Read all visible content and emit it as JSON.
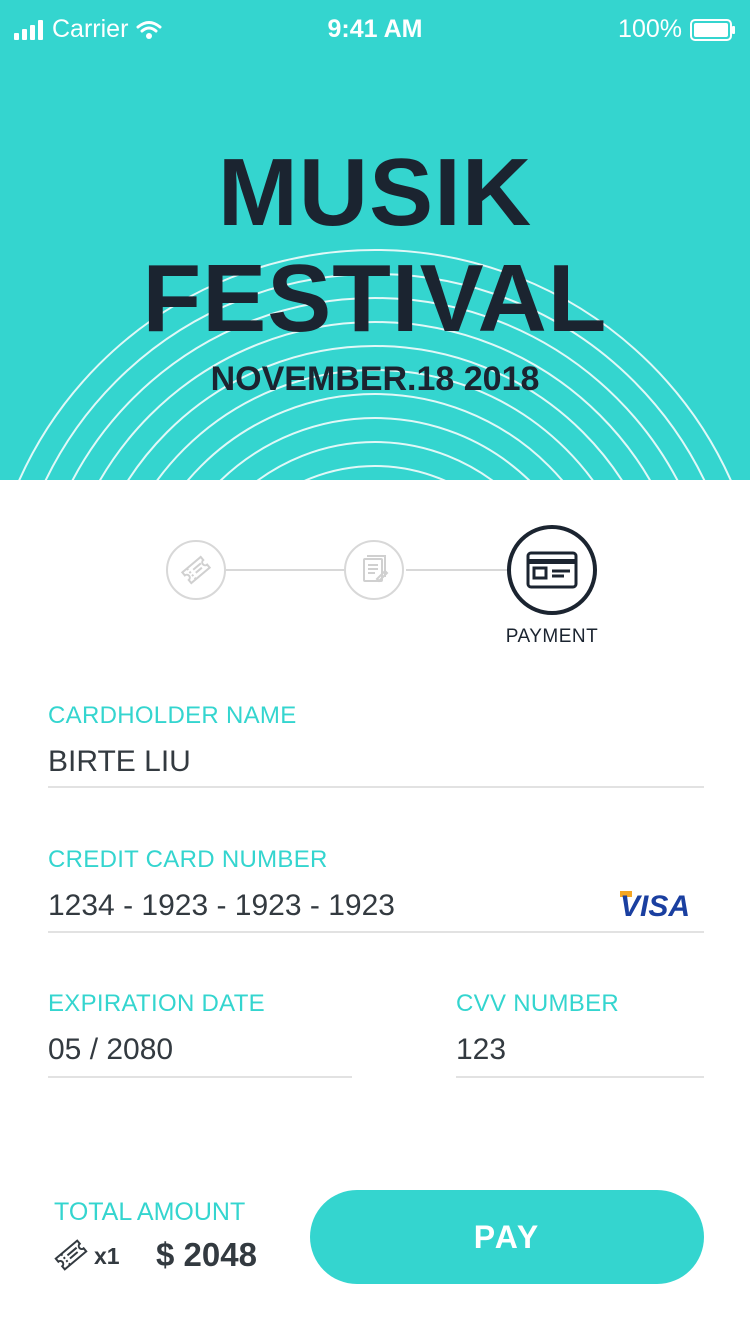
{
  "status_bar": {
    "carrier": "Carrier",
    "time": "9:41 AM",
    "battery": "100%"
  },
  "hero": {
    "title_line1": "MUSIK",
    "title_line2": "FESTIVAL",
    "date": "NOVEMBER.18 2018",
    "background_color": "#34d5cf"
  },
  "stepper": {
    "steps": [
      {
        "icon": "ticket-icon",
        "state": "completed"
      },
      {
        "icon": "document-icon",
        "state": "completed"
      },
      {
        "icon": "credit-card-icon",
        "state": "active",
        "label": "PAYMENT"
      }
    ]
  },
  "form": {
    "cardholder": {
      "label": "CARDHOLDER NAME",
      "value": "BIRTE LIU"
    },
    "card_number": {
      "label": "CREDIT CARD NUMBER",
      "value": "1234 - 1923 - 1923 - 1923",
      "brand": "VISA"
    },
    "expiration": {
      "label": "EXPIRATION DATE",
      "value": "05 / 2080"
    },
    "cvv": {
      "label": "CVV NUMBER",
      "value": "123"
    }
  },
  "footer": {
    "total_label": "TOTAL AMOUNT",
    "quantity": "x1",
    "amount": "$ 2048",
    "pay_label": "PAY"
  },
  "colors": {
    "accent": "#34d5cf",
    "dark": "#1b2430",
    "visa_blue": "#1a3fa0"
  }
}
